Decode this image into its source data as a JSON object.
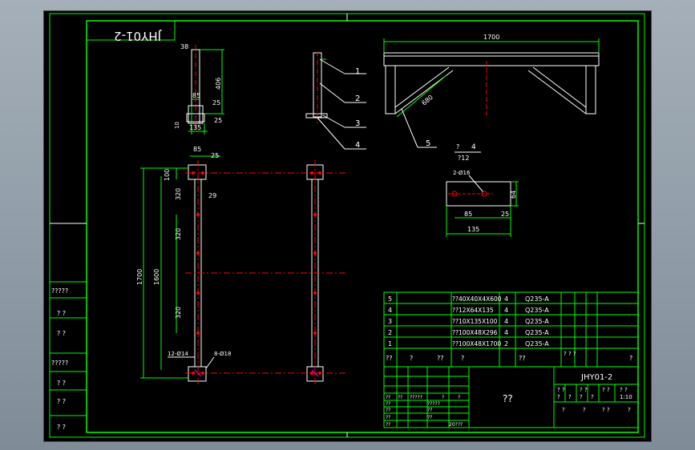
{
  "drawing": {
    "title_mirrored": "JHY01-2",
    "dims": {
      "overall_length": "1700",
      "diag_len": "680",
      "top_38": "38",
      "side_406": "406",
      "side_85": "85",
      "side_25a": "25",
      "side_25b": "25",
      "side_135": "135",
      "side_10": "10",
      "plan_85": "85",
      "plan_25": "25",
      "plan_100": "100",
      "plan_29": "29",
      "plan_320a": "320",
      "plan_320b": "320",
      "plan_320c": "320",
      "plan_1700": "1700",
      "plan_1600": "1600",
      "hole_12": "12-Ø14",
      "hole_8": "8-Ø18",
      "detail_num": "4",
      "detail_q": "?",
      "detail_sub": "?12",
      "detail_holes": "2-Ø16",
      "detail_64": "64",
      "detail_85": "85",
      "detail_25": "25",
      "detail_135": "135"
    },
    "balloons": [
      "1",
      "2",
      "3",
      "4",
      "5"
    ]
  },
  "bom": {
    "rows": [
      {
        "no": "5",
        "spec": "??40X40X4X600",
        "qty": "4",
        "mat": "Q235-A"
      },
      {
        "no": "4",
        "spec": "??12X64X135",
        "qty": "4",
        "mat": "Q235-A"
      },
      {
        "no": "3",
        "spec": "??10X135X100",
        "qty": "4",
        "mat": "Q235-A"
      },
      {
        "no": "2",
        "spec": "??100X48X296",
        "qty": "4",
        "mat": "Q235-A"
      },
      {
        "no": "1",
        "spec": "??100X48X1700",
        "qty": "2",
        "mat": "Q235-A"
      }
    ],
    "header": [
      "??",
      "?",
      "??",
      "?",
      "??",
      "? ? ?",
      "?"
    ]
  },
  "title_block": {
    "center": "??",
    "code": "JHY01-2",
    "cells_top": [
      "? ?",
      "? ?",
      "? ?",
      "? ?"
    ],
    "cells_mid": [
      "?",
      "?",
      "?",
      "?",
      "1:10"
    ],
    "cells_bot": [
      "?",
      "?",
      "? ?",
      "?"
    ],
    "left_rows": [
      "??",
      "??",
      "??",
      "??",
      "??"
    ],
    "left_sub": [
      "??",
      "??",
      "?????",
      "?",
      "?"
    ],
    "left_block": [
      "?????",
      "??",
      "??",
      "????"
    ],
    "sign_text": "20???"
  },
  "side_labels": [
    "?????",
    "?  ?",
    "?  ?",
    "?????",
    "?  ?",
    "?  ?",
    "?  ?"
  ],
  "colors": {
    "frame": "#00ff00",
    "line": "#ffffff",
    "center": "#ff0000",
    "hidden": "#ff00ff",
    "text": "#00ff00"
  }
}
